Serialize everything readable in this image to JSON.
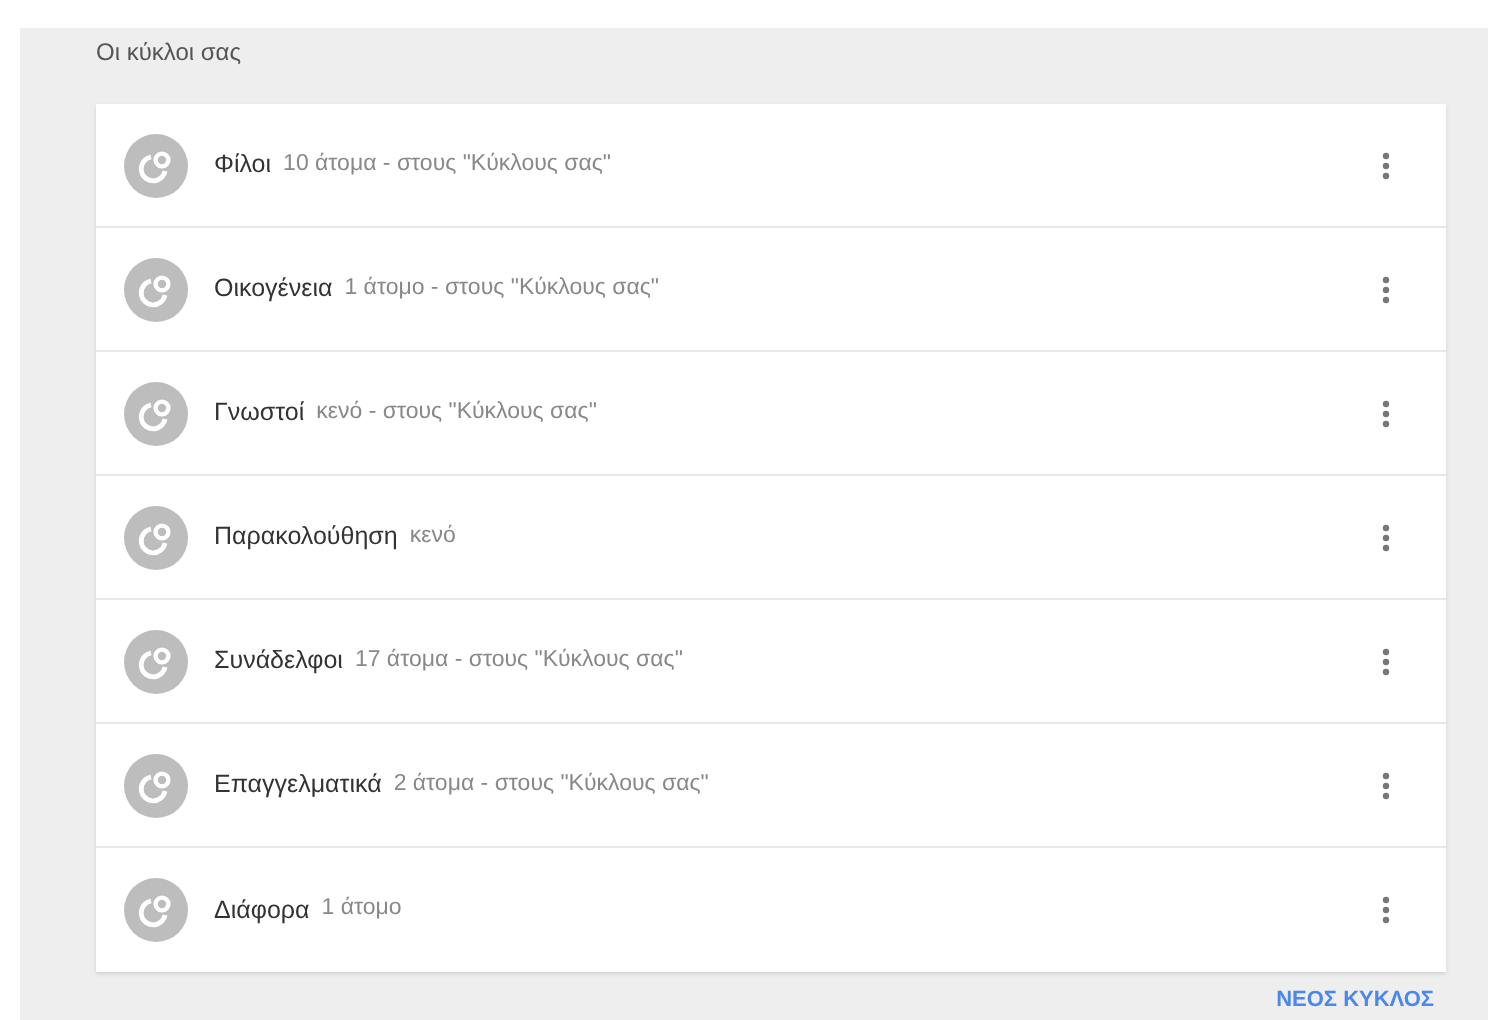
{
  "section_title": "Οι κύκλοι σας",
  "circles": [
    {
      "name": "Φίλοι",
      "detail": "10 άτομα - στους \"Κύκλους σας\""
    },
    {
      "name": "Οικογένεια",
      "detail": "1 άτομο - στους \"Κύκλους σας\""
    },
    {
      "name": "Γνωστοί",
      "detail": "κενό - στους \"Κύκλους σας\""
    },
    {
      "name": "Παρακολούθηση",
      "detail": "κενό"
    },
    {
      "name": "Συνάδελφοι",
      "detail": "17 άτομα - στους \"Κύκλους σας\""
    },
    {
      "name": "Επαγγελματικά",
      "detail": "2 άτομα - στους \"Κύκλους σας\""
    },
    {
      "name": "Διάφορα",
      "detail": "1 άτομο"
    }
  ],
  "new_circle_button": "ΝΕΟΣ ΚΥΚΛΟΣ"
}
